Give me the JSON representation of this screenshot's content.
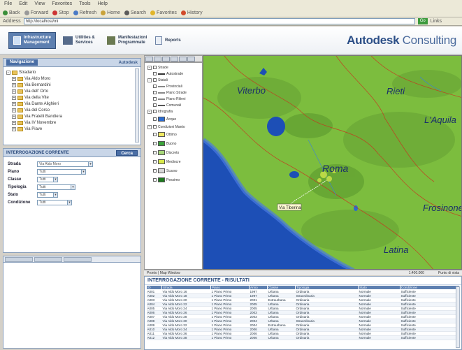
{
  "browser": {
    "menu": [
      "File",
      "Edit",
      "View",
      "Favorites",
      "Tools",
      "Help"
    ],
    "toolbar": [
      "Back",
      "Forward",
      "Stop",
      "Refresh",
      "Home",
      "Search",
      "Favorites",
      "History"
    ],
    "address_label": "Address",
    "address_value": "http://localhost/mi",
    "go_label": "Go",
    "links_label": "Links"
  },
  "app": {
    "brand_main": "Autodesk",
    "brand_sub": "Consulting",
    "nav": [
      {
        "label": "Infrastructure Management",
        "active": true
      },
      {
        "label": "Utilities & Services",
        "active": false
      },
      {
        "label": "Manifestazioni Programmate",
        "active": false
      },
      {
        "label": "Reports",
        "active": false
      }
    ]
  },
  "tree_panel": {
    "tab": "Navigazione",
    "brand": "Autodesk",
    "root": "Stradario",
    "items": [
      "Via Aldo Moro",
      "Via Bernardini",
      "Via dell' Orto",
      "Via della Vite",
      "Via Dante Alighieri",
      "Via del Corso",
      "Via Fratelli Bandiera",
      "Via IV Novembre",
      "Via Piave"
    ]
  },
  "query_panel": {
    "title": "INTERROGAZIONE CORRENTE",
    "button": "Cerca",
    "fields": [
      {
        "label": "Strada",
        "value": "Via Aldo Moro",
        "type": "select",
        "width": 80
      },
      {
        "label": "Piano",
        "value": "Tutti",
        "type": "select",
        "width": 70
      },
      {
        "label": "Classe",
        "value": "Tutti",
        "type": "select",
        "width": 30
      },
      {
        "label": "Tipologia",
        "value": "Tutti",
        "type": "select",
        "width": 55
      },
      {
        "label": "Stato",
        "value": "Tutti",
        "type": "select",
        "width": 30
      },
      {
        "label": "Condizione",
        "value": "Tutti",
        "type": "select",
        "width": 50
      }
    ]
  },
  "legend": {
    "items": [
      {
        "label": "Strade",
        "kind": "group"
      },
      {
        "label": "Autostrade",
        "kind": "line",
        "color": "#333333"
      },
      {
        "label": "Statali",
        "kind": "group"
      },
      {
        "label": "Provinciali",
        "kind": "line",
        "color": "#888888"
      },
      {
        "label": "Piano Strade",
        "kind": "line",
        "color": "#888888"
      },
      {
        "label": "Piano Rilievi",
        "kind": "line",
        "color": "#888888"
      },
      {
        "label": "Comunali",
        "kind": "line",
        "color": "#555555"
      },
      {
        "label": "Idrografia",
        "kind": "group"
      },
      {
        "label": "Acque",
        "kind": "swatch",
        "color": "#2a6bd1"
      },
      {
        "label": "Condizioni Manto",
        "kind": "group"
      },
      {
        "label": "Ottimo",
        "kind": "swatch",
        "color": "#f1ea63"
      },
      {
        "label": "Buono",
        "kind": "swatch",
        "color": "#3aa33a"
      },
      {
        "label": "Discreto",
        "kind": "swatch",
        "color": "#a7d77a"
      },
      {
        "label": "Mediocre",
        "kind": "swatch",
        "color": "#d8e84a"
      },
      {
        "label": "Scarso",
        "kind": "swatch",
        "color": "#d8d8d8"
      },
      {
        "label": "Pessimo",
        "kind": "swatch",
        "color": "#1e7a1e"
      }
    ]
  },
  "map": {
    "places": [
      {
        "name": "Viterbo"
      },
      {
        "name": "Rieti"
      },
      {
        "name": "L'Aquila"
      },
      {
        "name": "Roma"
      },
      {
        "name": "Frosinone"
      },
      {
        "name": "Latina"
      }
    ],
    "tooltip": "Via Tiberina",
    "sea_color": "#1d4fb6",
    "land_color": "#7cbd3e"
  },
  "statusbar": {
    "left": "Pronto | Map Window",
    "scale": "1:400.000",
    "coords": "Punto di vista"
  },
  "table": {
    "title": "INTERROGAZIONE CORRENTE - RISULTATI",
    "columns": [
      "ID",
      "Strada",
      "Piano",
      "Anno",
      "Classe",
      "Tipologia",
      "Stato",
      "Condizione"
    ],
    "rows": [
      [
        "A001",
        "Via Aldo Moro 16",
        "1 Piano Primo",
        "1997",
        "Urbana",
        "Ordinaria",
        "Normale",
        "Sufficiente"
      ],
      [
        "A002",
        "Via Aldo Moro 18",
        "1 Piano Primo",
        "1997",
        "Urbana",
        "Straordinaria",
        "Normale",
        "Sufficiente"
      ],
      [
        "A003",
        "Via Aldo Moro 20",
        "1 Piano Primo",
        "2001",
        "Extraurbana",
        "Ordinaria",
        "Normale",
        "Sufficiente"
      ],
      [
        "A004",
        "Via Aldo Moro 22",
        "1 Piano Primo",
        "2005",
        "Urbana",
        "Ordinaria",
        "Normale",
        "Sufficiente"
      ],
      [
        "A005",
        "Via Aldo Moro 24",
        "1 Piano Primo",
        "2005",
        "Urbana",
        "Ordinaria",
        "Normale",
        "Sufficiente"
      ],
      [
        "A006",
        "Via Aldo Moro 26",
        "1 Piano Primo",
        "2003",
        "Urbana",
        "Ordinaria",
        "Normale",
        "Sufficiente"
      ],
      [
        "A007",
        "Via Aldo Moro 28",
        "1 Piano Primo",
        "2003",
        "Urbana",
        "Ordinaria",
        "Normale",
        "Sufficiente"
      ],
      [
        "A008",
        "Via Aldo Moro 30",
        "1 Piano Primo",
        "2004",
        "Urbana",
        "Straordinaria",
        "Normale",
        "Sufficiente"
      ],
      [
        "A009",
        "Via Aldo Moro 32",
        "1 Piano Primo",
        "2004",
        "Extraurbana",
        "Ordinaria",
        "Normale",
        "Sufficiente"
      ],
      [
        "A010",
        "Via Aldo Moro 34",
        "1 Piano Primo",
        "2006",
        "Urbana",
        "Ordinaria",
        "Normale",
        "Sufficiente"
      ],
      [
        "A011",
        "Via Aldo Moro 36",
        "1 Piano Primo",
        "2006",
        "Urbana",
        "Ordinaria",
        "Normale",
        "Sufficiente"
      ],
      [
        "A012",
        "Via Aldo Moro 38",
        "1 Piano Primo",
        "2006",
        "Urbana",
        "Ordinaria",
        "Normale",
        "Sufficiente"
      ]
    ]
  }
}
